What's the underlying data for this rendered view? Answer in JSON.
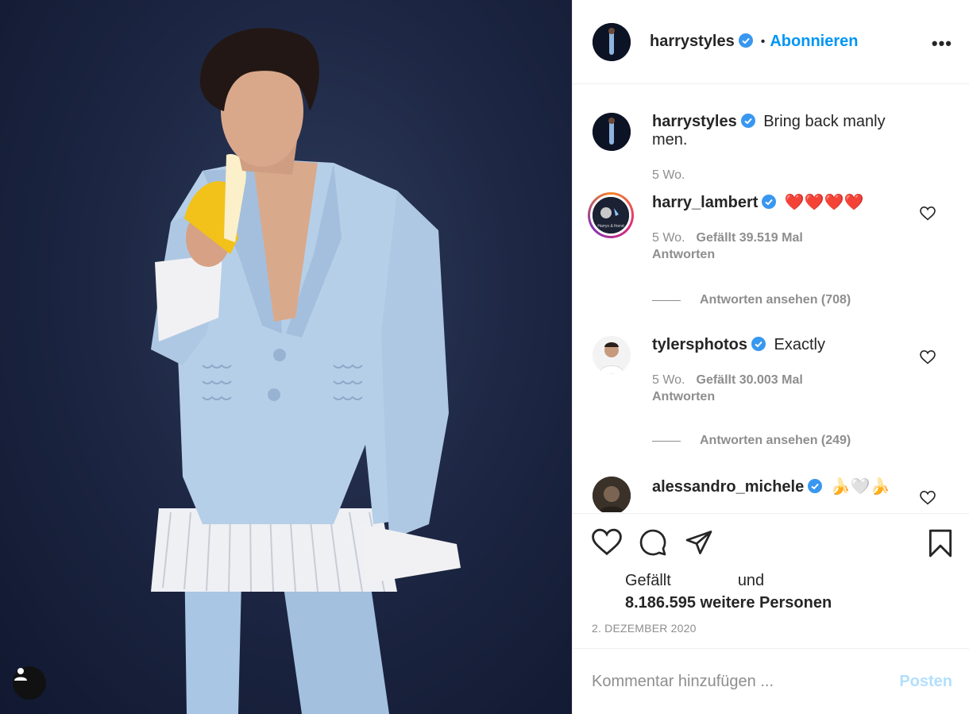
{
  "post": {
    "author": "harrystyles",
    "separator": "•",
    "follow_label": "Abonnieren",
    "more_label": "•••"
  },
  "caption": {
    "user": "harrystyles",
    "text": "Bring back manly men.",
    "age": "5 Wo."
  },
  "comments": [
    {
      "user": "harry_lambert",
      "text": "❤️❤️❤️❤️",
      "age": "5 Wo.",
      "likes": "Gefällt 39.519 Mal",
      "reply_label": "Antworten",
      "view_replies": "Antworten ansehen (708)",
      "avatar_text": "Harrys & friend"
    },
    {
      "user": "tylersphotos",
      "text": "Exactly",
      "age": "5 Wo.",
      "likes": "Gefällt 30.003 Mal",
      "reply_label": "Antworten",
      "view_replies": "Antworten ansehen (249)"
    },
    {
      "user": "alessandro_michele",
      "text": "🍌🤍🍌"
    }
  ],
  "likes": {
    "prefix": "Gefällt",
    "conjunction": "und",
    "count_text": "8.186.595 weitere Personen"
  },
  "date": "2. DEZEMBER 2020",
  "comment_box": {
    "placeholder": "Kommentar hinzufügen ...",
    "post_label": "Posten"
  },
  "colors": {
    "accent": "#0095f6",
    "verified": "#3897f0",
    "heart": "#ed4956",
    "post_disabled": "#b2dffc"
  }
}
